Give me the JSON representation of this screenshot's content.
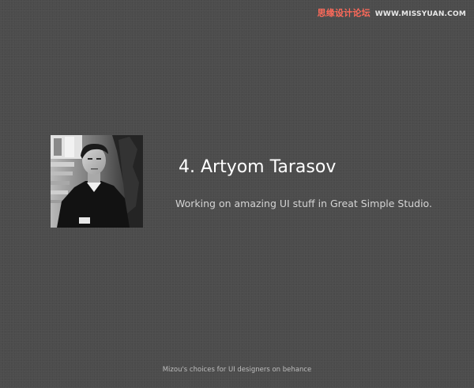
{
  "watermark": {
    "chinese": "思缘设计论坛",
    "site": "WWW.MISSYUAN.COM"
  },
  "profile": {
    "photo_icon": "portrait-photo",
    "name": "4. Artyom Tarasov",
    "description": "Working on amazing UI stuff in Great Simple Studio."
  },
  "footer": {
    "text": "Mizou's choices for UI designers on behance"
  },
  "colors": {
    "background": "#4c4c4c",
    "title": "#ffffff",
    "body_text": "#d4d4d4",
    "watermark_accent": "#ff6a5a"
  }
}
